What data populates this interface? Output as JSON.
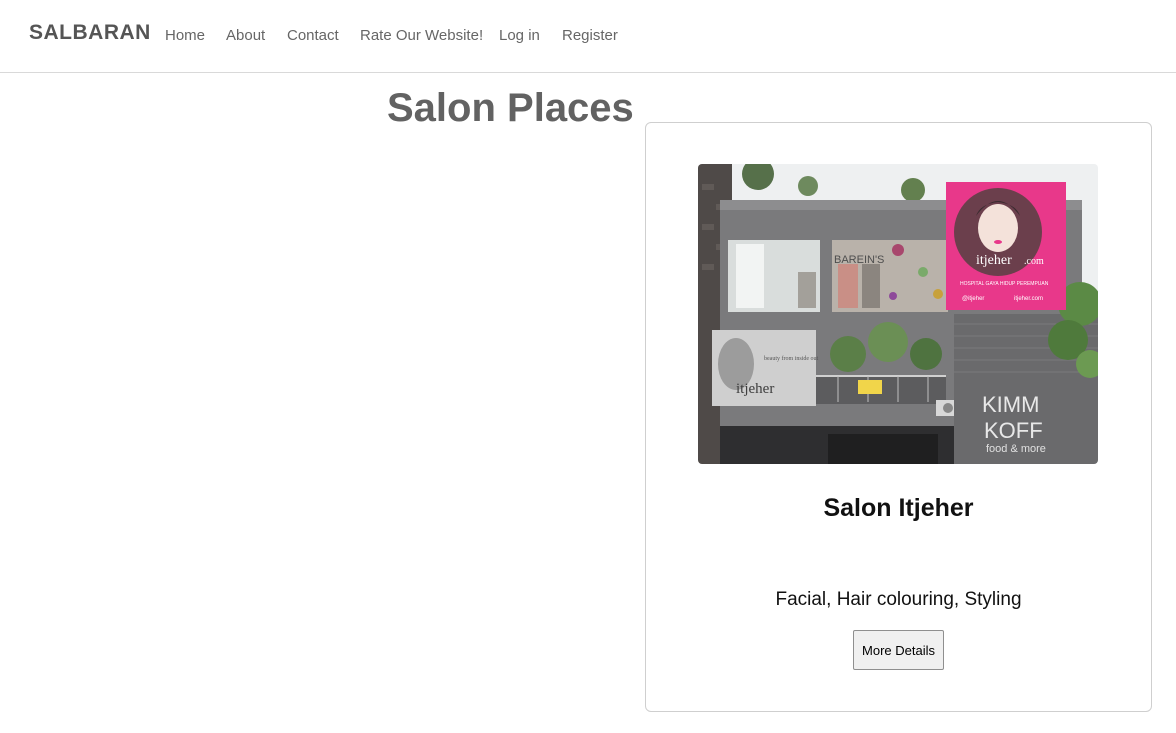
{
  "nav": {
    "brand": "SALBARAN",
    "links": [
      "Home",
      "About",
      "Contact",
      "Rate Our Website!",
      "Log in",
      "Register"
    ]
  },
  "main": {
    "title": "Salon Places"
  },
  "card": {
    "title": "Salon Itjeher",
    "services": "Facial, Hair colouring, Styling",
    "button_label": "More Details",
    "photo_signage": {
      "billboard_brand": "itjeher",
      "billboard_domain": ".com",
      "billboard_tagline": "HOSPITAL GAYA HIDUP PEREMPUAN",
      "billboard_social": "@itjeher",
      "billboard_facebook": "itjeher.com",
      "window_sign": "BAREIN'S",
      "poster_brand": "itjeher",
      "poster_tagline": "beauty from inside out",
      "neighbor_line1": "KIMM",
      "neighbor_line2": "KOFF",
      "neighbor_line3": "food & more"
    }
  },
  "colors": {
    "brand": "#555555",
    "billboard": "#e8388a",
    "building": "#7a7a7c"
  }
}
